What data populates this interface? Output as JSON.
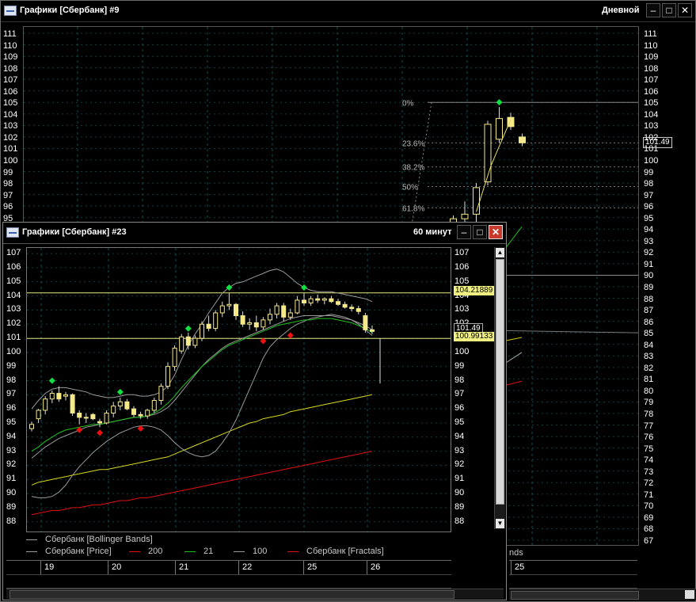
{
  "win_back": {
    "title": "Графики [Сбербанк] #9",
    "period": "Дневной",
    "price_ticks": [
      "111",
      "110",
      "109",
      "108",
      "107",
      "106",
      "105",
      "104",
      "103",
      "102",
      "101",
      "100",
      "99",
      "98",
      "97",
      "96",
      "95",
      "94",
      "93",
      "92",
      "91",
      "90",
      "89",
      "88",
      "87",
      "86",
      "85",
      "84",
      "83",
      "82",
      "81",
      "80",
      "79",
      "78",
      "77",
      "76",
      "75",
      "74",
      "73",
      "72",
      "71",
      "70",
      "69",
      "68",
      "67"
    ],
    "left_ticks": [
      "111",
      "110",
      "109",
      "108",
      "107",
      "106",
      "105",
      "104",
      "103",
      "102",
      "101",
      "100",
      "99",
      "98",
      "97",
      "96",
      "95"
    ],
    "fib_levels": [
      "0%",
      "23.6%",
      "38.2%",
      "50%",
      "61.8%"
    ],
    "last_price": "101.49",
    "legend_fragment": "nds",
    "date_fragment": "25",
    "candles": [
      {
        "o": 93.4,
        "h": 94.6,
        "l": 93.0,
        "c": 94.1
      },
      {
        "o": 94.1,
        "h": 95.2,
        "l": 93.8,
        "c": 94.9
      },
      {
        "o": 94.9,
        "h": 96.4,
        "l": 94.5,
        "c": 95.3
      },
      {
        "o": 95.3,
        "h": 98.0,
        "l": 94.6,
        "c": 97.6
      },
      {
        "o": 98.1,
        "h": 103.4,
        "l": 97.8,
        "c": 103.1
      },
      {
        "o": 101.8,
        "h": 104.6,
        "l": 101.5,
        "c": 103.6
      },
      {
        "o": 103.7,
        "h": 104.1,
        "l": 102.6,
        "c": 102.9
      },
      {
        "o": 102.0,
        "h": 102.3,
        "l": 101.2,
        "c": 101.49
      }
    ],
    "fractal_up": [
      {
        "index": 5,
        "price": 104.6
      }
    ]
  },
  "win_front": {
    "title": "Графики [Сбербанк] #23",
    "period": "60 минут",
    "price_ticks": [
      "107",
      "106",
      "105",
      "104",
      "103",
      "102",
      "101",
      "100",
      "99",
      "98",
      "97",
      "96",
      "95",
      "94",
      "93",
      "92",
      "91",
      "90",
      "89",
      "88"
    ],
    "tag_upper": "104.21889",
    "tag_price": "101.49",
    "tag_lower": "100.99133",
    "dates": [
      "19",
      "20",
      "21",
      "22",
      "25",
      "26"
    ],
    "legend": [
      {
        "label": "Сбербанк [Bollinger Bands]",
        "color": "#9a9a9a"
      },
      {
        "label": "Сбербанк [Price]",
        "color": "#9a9a9a"
      },
      {
        "label": "200",
        "color": "#e01010"
      },
      {
        "label": "21",
        "color": "#20c020"
      },
      {
        "label": "100",
        "color": "#9a9a9a"
      },
      {
        "label": "Сбербанк [Fractals]",
        "color": "#e01010"
      }
    ],
    "candles": [
      {
        "o": 94.6,
        "h": 95.1,
        "l": 94.4,
        "c": 94.9
      },
      {
        "o": 95.3,
        "h": 96.0,
        "l": 95.0,
        "c": 95.9
      },
      {
        "o": 95.9,
        "h": 96.9,
        "l": 95.6,
        "c": 96.7
      },
      {
        "o": 96.7,
        "h": 97.3,
        "l": 96.4,
        "c": 97.1
      },
      {
        "o": 97.1,
        "h": 97.6,
        "l": 96.5,
        "c": 96.7
      },
      {
        "o": 96.9,
        "h": 97.2,
        "l": 96.6,
        "c": 97.0
      },
      {
        "o": 97.0,
        "h": 97.1,
        "l": 95.5,
        "c": 95.7
      },
      {
        "o": 95.7,
        "h": 95.9,
        "l": 94.9,
        "c": 95.4
      },
      {
        "o": 95.4,
        "h": 95.7,
        "l": 95.0,
        "c": 95.4
      },
      {
        "o": 95.6,
        "h": 95.7,
        "l": 95.2,
        "c": 95.3
      },
      {
        "o": 95.1,
        "h": 95.3,
        "l": 94.7,
        "c": 95.0
      },
      {
        "o": 95.0,
        "h": 95.9,
        "l": 94.9,
        "c": 95.7
      },
      {
        "o": 95.7,
        "h": 96.5,
        "l": 95.4,
        "c": 96.2
      },
      {
        "o": 96.2,
        "h": 96.8,
        "l": 95.9,
        "c": 96.5
      },
      {
        "o": 96.5,
        "h": 96.7,
        "l": 95.9,
        "c": 96.0
      },
      {
        "o": 96.0,
        "h": 96.2,
        "l": 95.4,
        "c": 95.6
      },
      {
        "o": 95.6,
        "h": 95.8,
        "l": 95.3,
        "c": 95.5
      },
      {
        "o": 95.5,
        "h": 96.0,
        "l": 95.3,
        "c": 95.9
      },
      {
        "o": 95.9,
        "h": 96.8,
        "l": 95.7,
        "c": 96.6
      },
      {
        "o": 96.6,
        "h": 97.8,
        "l": 96.3,
        "c": 97.6
      },
      {
        "o": 97.6,
        "h": 99.3,
        "l": 97.4,
        "c": 99.0
      },
      {
        "o": 99.0,
        "h": 100.5,
        "l": 98.7,
        "c": 100.3
      },
      {
        "o": 100.1,
        "h": 101.3,
        "l": 99.9,
        "c": 101.1
      },
      {
        "o": 101.1,
        "h": 101.4,
        "l": 100.2,
        "c": 100.5
      },
      {
        "o": 100.5,
        "h": 101.2,
        "l": 100.3,
        "c": 101.0
      },
      {
        "o": 101.0,
        "h": 102.2,
        "l": 100.8,
        "c": 102.0
      },
      {
        "o": 102.0,
        "h": 102.6,
        "l": 101.5,
        "c": 101.7
      },
      {
        "o": 101.7,
        "h": 103.0,
        "l": 101.5,
        "c": 102.8
      },
      {
        "o": 102.8,
        "h": 103.6,
        "l": 102.5,
        "c": 103.3
      },
      {
        "o": 103.3,
        "h": 104.2,
        "l": 103.0,
        "c": 103.4
      },
      {
        "o": 103.4,
        "h": 103.5,
        "l": 102.3,
        "c": 102.6
      },
      {
        "o": 102.6,
        "h": 102.9,
        "l": 101.8,
        "c": 102.0
      },
      {
        "o": 102.0,
        "h": 102.4,
        "l": 101.6,
        "c": 102.1
      },
      {
        "o": 102.1,
        "h": 102.6,
        "l": 101.5,
        "c": 101.8
      },
      {
        "o": 101.8,
        "h": 102.5,
        "l": 101.6,
        "c": 102.3
      },
      {
        "o": 102.3,
        "h": 103.1,
        "l": 102.0,
        "c": 102.7
      },
      {
        "o": 102.7,
        "h": 103.5,
        "l": 102.4,
        "c": 103.3
      },
      {
        "o": 103.3,
        "h": 103.5,
        "l": 102.2,
        "c": 102.5
      },
      {
        "o": 102.5,
        "h": 103.1,
        "l": 102.3,
        "c": 102.8
      },
      {
        "o": 102.8,
        "h": 104.0,
        "l": 102.7,
        "c": 103.7
      },
      {
        "o": 103.7,
        "h": 104.2,
        "l": 103.3,
        "c": 103.5
      },
      {
        "o": 103.5,
        "h": 104.0,
        "l": 103.3,
        "c": 103.8
      },
      {
        "o": 103.8,
        "h": 104.1,
        "l": 103.5,
        "c": 103.7
      },
      {
        "o": 103.7,
        "h": 103.9,
        "l": 103.4,
        "c": 103.8
      },
      {
        "o": 103.8,
        "h": 104.0,
        "l": 103.5,
        "c": 103.6
      },
      {
        "o": 103.6,
        "h": 103.8,
        "l": 103.3,
        "c": 103.4
      },
      {
        "o": 103.4,
        "h": 103.6,
        "l": 103.1,
        "c": 103.2
      },
      {
        "o": 103.2,
        "h": 103.4,
        "l": 102.9,
        "c": 103.1
      },
      {
        "o": 103.1,
        "h": 103.3,
        "l": 102.7,
        "c": 102.9
      },
      {
        "o": 102.6,
        "h": 102.8,
        "l": 101.4,
        "c": 101.6
      },
      {
        "o": 101.6,
        "h": 101.9,
        "l": 101.3,
        "c": 101.49
      }
    ],
    "fractal_up": [
      {
        "index": 3,
        "price": 97.6
      },
      {
        "index": 13,
        "price": 96.8
      },
      {
        "index": 23,
        "price": 101.3
      },
      {
        "index": 29,
        "price": 104.2
      },
      {
        "index": 40,
        "price": 104.2
      }
    ],
    "fractal_down": [
      {
        "index": 7,
        "price": 94.9
      },
      {
        "index": 10,
        "price": 94.7
      },
      {
        "index": 16,
        "price": 95.0
      },
      {
        "index": 34,
        "price": 101.2
      },
      {
        "index": 38,
        "price": 101.6
      }
    ],
    "bb_upper": [
      96.0,
      96.6,
      97.1,
      97.4,
      97.5,
      97.5,
      97.4,
      97.3,
      97.2,
      97.0,
      96.9,
      96.8,
      96.8,
      96.9,
      97.0,
      97.0,
      96.9,
      96.9,
      97.0,
      97.2,
      97.6,
      98.4,
      99.5,
      100.5,
      101.3,
      102.0,
      102.8,
      103.5,
      104.2,
      104.6,
      104.9,
      105.0,
      105.2,
      105.4,
      105.6,
      105.8,
      105.9,
      105.7,
      105.3,
      104.9,
      104.6,
      104.4,
      104.3,
      104.3,
      104.3,
      104.2,
      104.1,
      104.0,
      103.9,
      103.8,
      103.6
    ],
    "bb_lower": [
      89.8,
      89.7,
      89.7,
      89.8,
      90.1,
      90.6,
      91.3,
      91.9,
      92.4,
      92.9,
      93.3,
      93.7,
      94.0,
      94.3,
      94.5,
      94.7,
      94.8,
      94.8,
      94.7,
      94.5,
      94.1,
      93.6,
      93.2,
      92.9,
      92.7,
      92.6,
      92.7,
      93.0,
      93.6,
      94.3,
      95.2,
      96.3,
      97.4,
      98.5,
      99.6,
      100.4,
      100.9,
      101.3,
      101.7,
      102.0,
      102.2,
      102.4,
      102.5,
      102.6,
      102.7,
      102.6,
      102.5,
      102.3,
      102.0,
      101.6,
      101.2
    ],
    "bb_mid": [
      92.5,
      92.9,
      93.3,
      93.6,
      93.9,
      94.1,
      94.3,
      94.5,
      94.7,
      94.8,
      94.9,
      95.0,
      95.1,
      95.2,
      95.3,
      95.4,
      95.4,
      95.5,
      95.6,
      95.8,
      96.1,
      96.6,
      97.2,
      97.8,
      98.4,
      99.0,
      99.5,
      99.9,
      100.3,
      100.6,
      100.8,
      101.0,
      101.2,
      101.4,
      101.6,
      101.8,
      102.0,
      102.2,
      102.4,
      102.5,
      102.6,
      102.6,
      102.6,
      102.6,
      102.6,
      102.5,
      102.4,
      102.3,
      102.1,
      101.9,
      101.6
    ],
    "ma21": [
      93.0,
      93.3,
      93.7,
      94.0,
      94.3,
      94.5,
      94.6,
      94.7,
      94.8,
      94.9,
      94.9,
      95.0,
      95.1,
      95.2,
      95.3,
      95.4,
      95.4,
      95.5,
      95.7,
      96.0,
      96.4,
      96.9,
      97.5,
      98.0,
      98.5,
      99.0,
      99.4,
      99.8,
      100.2,
      100.5,
      100.7,
      100.9,
      101.1,
      101.3,
      101.5,
      101.7,
      101.9,
      102.0,
      102.1,
      102.2,
      102.3,
      102.3,
      102.4,
      102.4,
      102.4,
      102.3,
      102.2,
      102.1,
      101.9,
      101.7,
      101.4
    ],
    "ma100": [
      90.6,
      90.8,
      90.9,
      91.0,
      91.1,
      91.2,
      91.3,
      91.4,
      91.5,
      91.6,
      91.7,
      91.7,
      91.8,
      91.9,
      92.0,
      92.1,
      92.2,
      92.3,
      92.4,
      92.5,
      92.6,
      92.8,
      93.0,
      93.2,
      93.4,
      93.6,
      93.8,
      94.0,
      94.2,
      94.4,
      94.6,
      94.8,
      95.0,
      95.1,
      95.3,
      95.4,
      95.5,
      95.6,
      95.8,
      95.9,
      96.0,
      96.1,
      96.2,
      96.3,
      96.4,
      96.5,
      96.6,
      96.7,
      96.8,
      96.9,
      97.0
    ],
    "ma200": [
      88.5,
      88.6,
      88.7,
      88.8,
      88.8,
      88.9,
      89.0,
      89.0,
      89.1,
      89.2,
      89.2,
      89.3,
      89.4,
      89.5,
      89.5,
      89.6,
      89.7,
      89.7,
      89.8,
      89.9,
      90.0,
      90.1,
      90.2,
      90.3,
      90.4,
      90.5,
      90.6,
      90.7,
      90.8,
      90.9,
      91.0,
      91.1,
      91.2,
      91.3,
      91.4,
      91.5,
      91.6,
      91.7,
      91.8,
      91.9,
      92.0,
      92.1,
      92.2,
      92.3,
      92.4,
      92.5,
      92.6,
      92.7,
      92.8,
      92.9,
      93.0
    ]
  }
}
